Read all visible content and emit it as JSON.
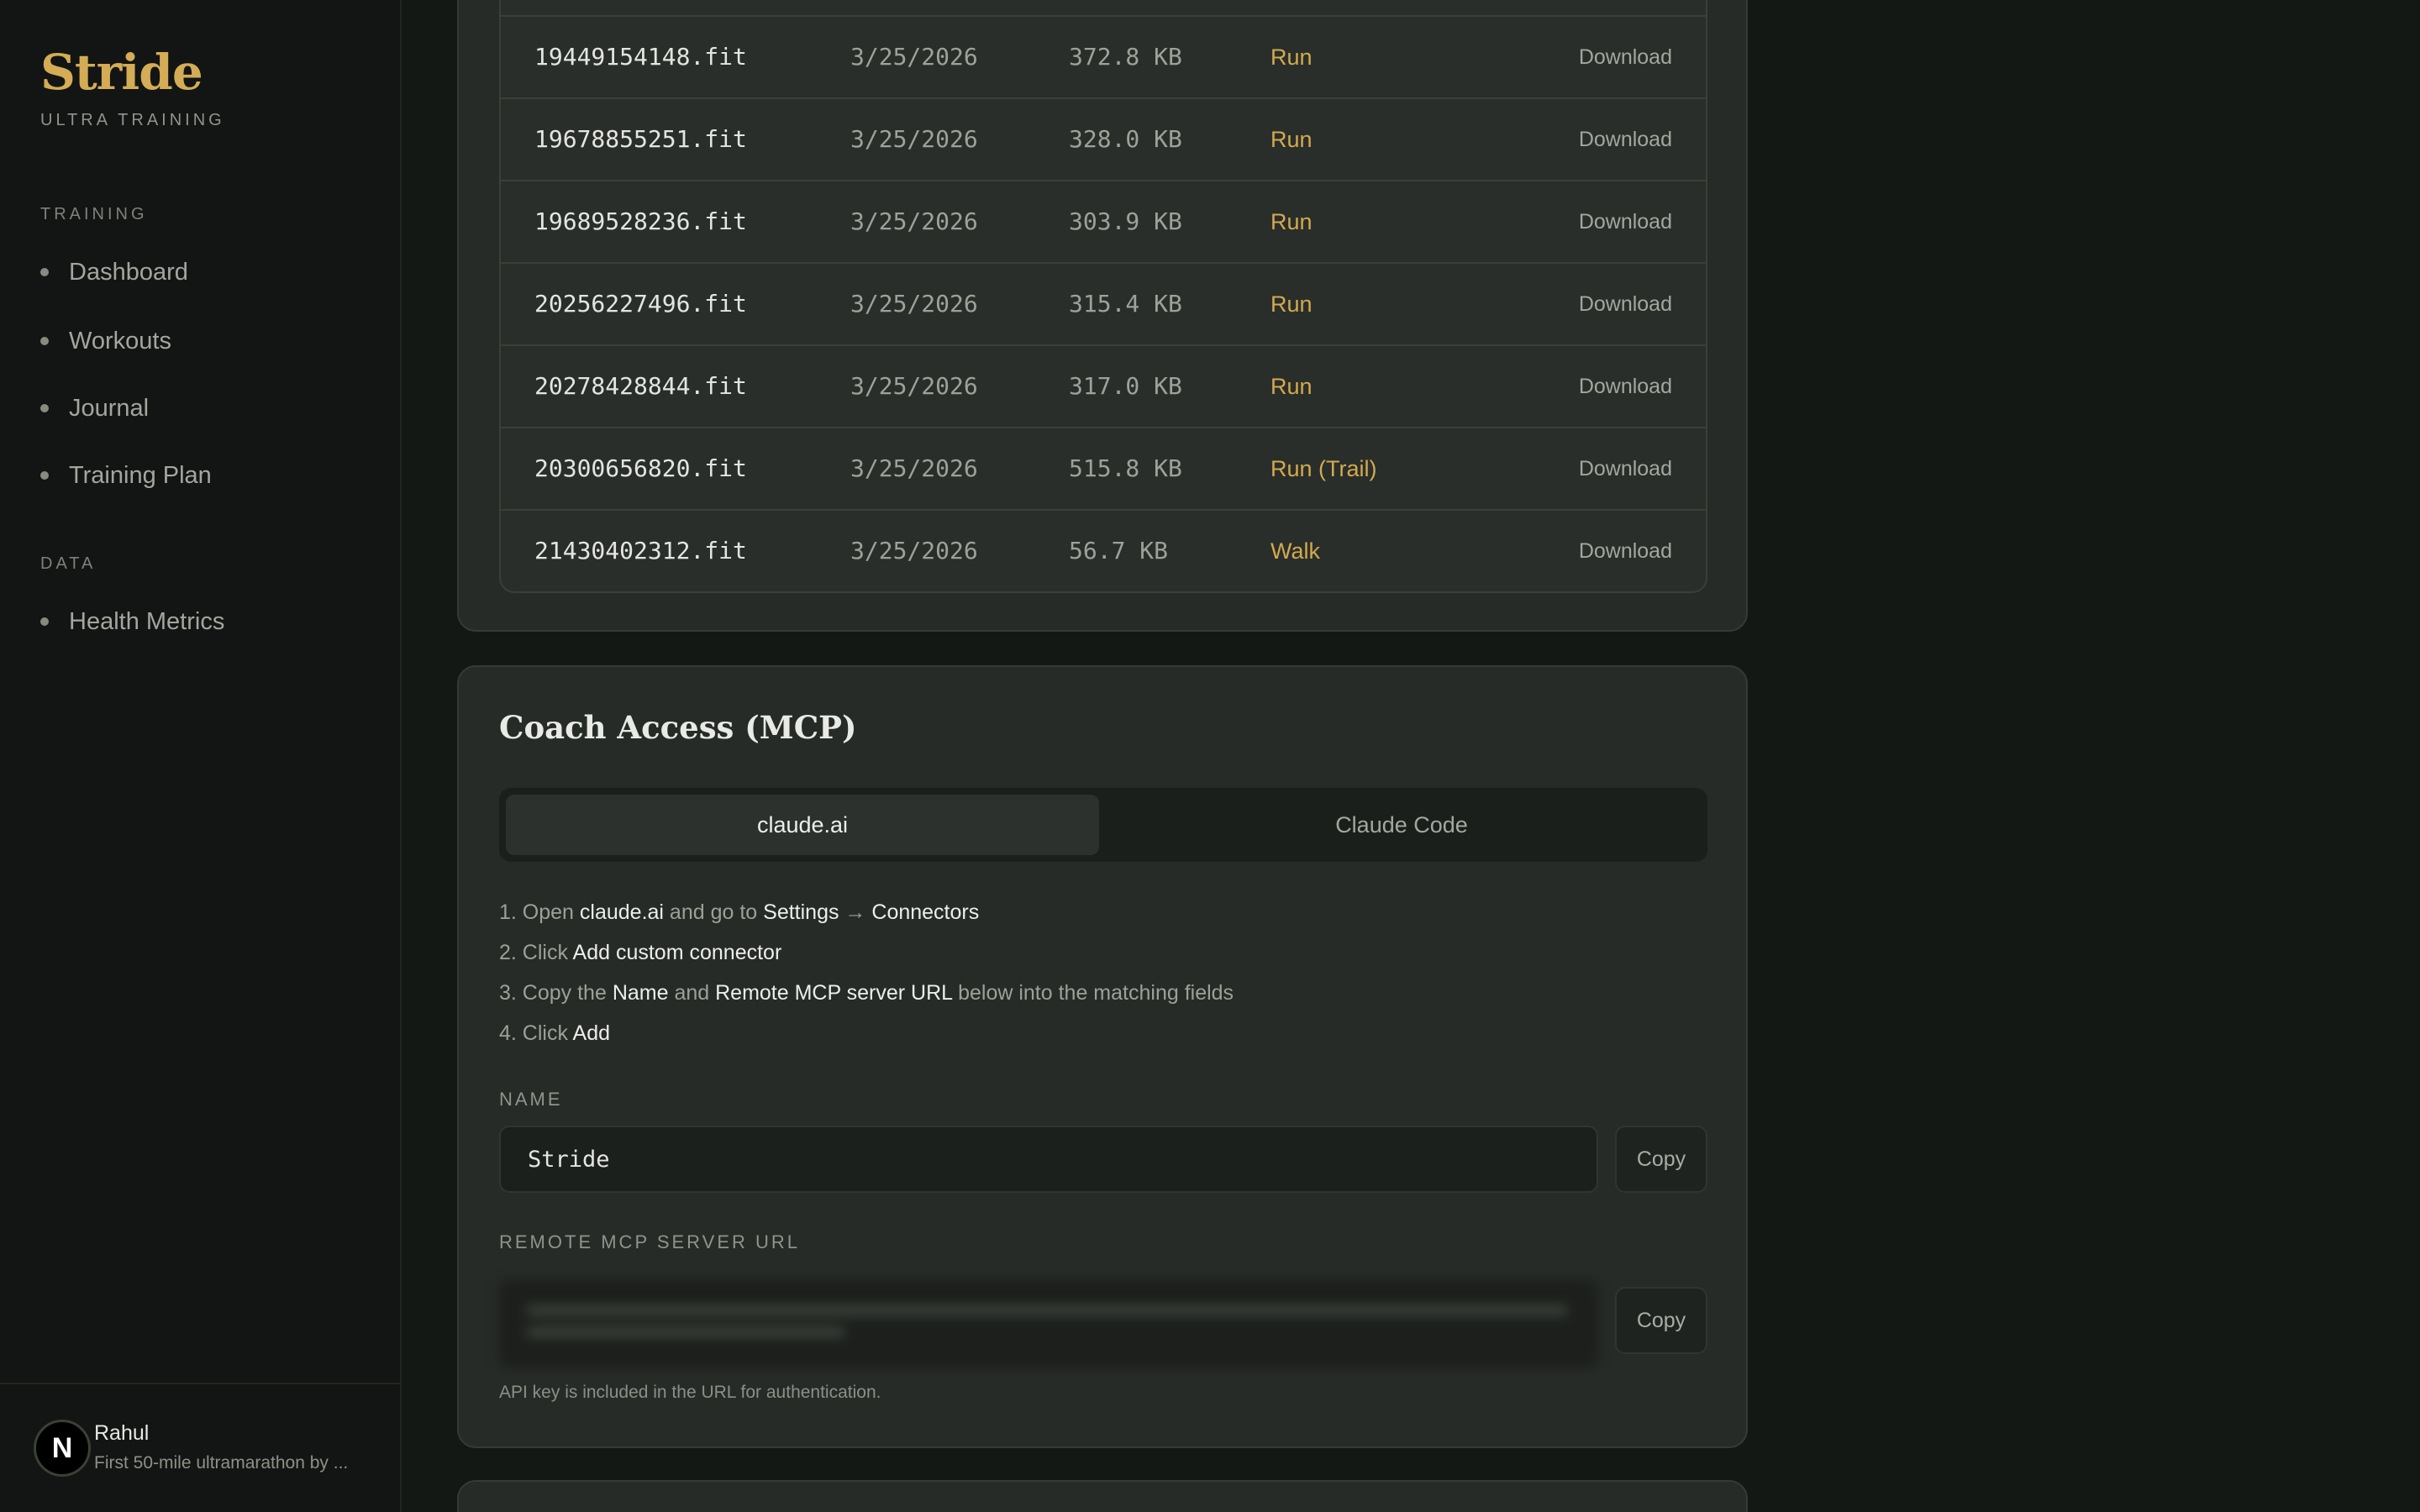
{
  "sidebar": {
    "brand": "Stride",
    "tagline": "ULTRA TRAINING",
    "sections": [
      {
        "title": "TRAINING",
        "items": [
          "Dashboard",
          "Workouts",
          "Journal",
          "Training Plan"
        ]
      },
      {
        "title": "DATA",
        "items": [
          "Health Metrics"
        ]
      }
    ],
    "user": {
      "initial": "N",
      "name": "Rahul",
      "goal": "First 50-mile ultramarathon by ..."
    }
  },
  "files": {
    "download_label": "Download",
    "rows": [
      {
        "name": "",
        "date": "",
        "size": "",
        "type": ""
      },
      {
        "name": "19449154148.fit",
        "date": "3/25/2026",
        "size": "372.8 KB",
        "type": "Run"
      },
      {
        "name": "19678855251.fit",
        "date": "3/25/2026",
        "size": "328.0 KB",
        "type": "Run"
      },
      {
        "name": "19689528236.fit",
        "date": "3/25/2026",
        "size": "303.9 KB",
        "type": "Run"
      },
      {
        "name": "20256227496.fit",
        "date": "3/25/2026",
        "size": "315.4 KB",
        "type": "Run"
      },
      {
        "name": "20278428844.fit",
        "date": "3/25/2026",
        "size": "317.0 KB",
        "type": "Run"
      },
      {
        "name": "20300656820.fit",
        "date": "3/25/2026",
        "size": "515.8 KB",
        "type": "Run (Trail)"
      },
      {
        "name": "21430402312.fit",
        "date": "3/25/2026",
        "size": "56.7 KB",
        "type": "Walk"
      }
    ]
  },
  "coach": {
    "title": "Coach Access (MCP)",
    "tabs": [
      "claude.ai",
      "Claude Code"
    ],
    "steps": [
      [
        [
          "1. Open ",
          false
        ],
        [
          "claude.ai",
          true
        ],
        [
          " and go to ",
          false
        ],
        [
          "Settings",
          true
        ],
        [
          " → ",
          false
        ],
        [
          "Connectors",
          true
        ]
      ],
      [
        [
          "2. Click ",
          false
        ],
        [
          "Add custom connector",
          true
        ]
      ],
      [
        [
          "3. Copy the ",
          false
        ],
        [
          "Name",
          true
        ],
        [
          " and ",
          false
        ],
        [
          "Remote MCP server URL",
          true
        ],
        [
          " below into the matching fields",
          false
        ]
      ],
      [
        [
          "4. Click ",
          false
        ],
        [
          "Add",
          true
        ]
      ]
    ],
    "name_label": "NAME",
    "name_value": "Stride",
    "url_label": "REMOTE MCP SERVER URL",
    "copy_label": "Copy",
    "note": "API key is included in the URL for authentication."
  }
}
